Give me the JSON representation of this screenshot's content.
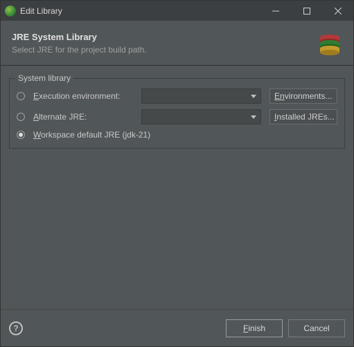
{
  "window": {
    "title": "Edit Library"
  },
  "header": {
    "title": "JRE System Library",
    "subtitle": "Select JRE for the project build path."
  },
  "group": {
    "legend": "System library",
    "exec_env": {
      "prefix": "E",
      "label": "xecution environment:",
      "button_prefix": "En",
      "button_rest": "vironments..."
    },
    "alt_jre": {
      "prefix": "A",
      "label": "lternate JRE:",
      "button_prefix": "I",
      "button_rest": "nstalled JREs..."
    },
    "workspace": {
      "prefix": "W",
      "label": "orkspace default JRE (jdk-21)"
    }
  },
  "footer": {
    "finish_prefix": "F",
    "finish_rest": "inish",
    "cancel": "Cancel",
    "help": "?"
  }
}
